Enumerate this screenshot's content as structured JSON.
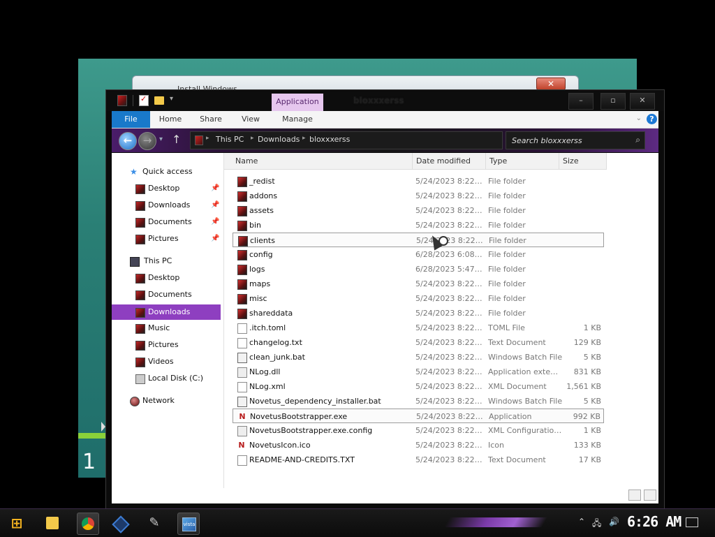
{
  "background_window": {
    "title": "Install Windows",
    "close_label": "✕",
    "side_digit": "1"
  },
  "explorer": {
    "title": "bloxxxerss",
    "contextual_tab_group": "Application Tools",
    "window_controls": {
      "minimize": "–",
      "maximize": "▫",
      "close": "✕"
    },
    "ribbon_tabs": [
      "File",
      "Home",
      "Share",
      "View",
      "Manage"
    ],
    "help_label": "?",
    "address": {
      "crumbs": [
        "This PC",
        "Downloads",
        "bloxxxerss"
      ]
    },
    "search": {
      "placeholder": "Search bloxxxerss"
    },
    "nav_pane": {
      "quick_access": {
        "label": "Quick access",
        "items": [
          "Desktop",
          "Downloads",
          "Documents",
          "Pictures"
        ]
      },
      "this_pc": {
        "label": "This PC",
        "items": [
          "Desktop",
          "Documents",
          "Downloads",
          "Music",
          "Pictures",
          "Videos",
          "Local Disk (C:)"
        ],
        "selected": "Downloads"
      },
      "network": {
        "label": "Network"
      }
    },
    "columns": [
      "Name",
      "Date modified",
      "Type",
      "Size"
    ],
    "files": [
      {
        "name": "_redist",
        "date": "5/24/2023 8:22…",
        "type": "File folder",
        "size": "",
        "icon": "folder"
      },
      {
        "name": "addons",
        "date": "5/24/2023 8:22…",
        "type": "File folder",
        "size": "",
        "icon": "folder"
      },
      {
        "name": "assets",
        "date": "5/24/2023 8:22…",
        "type": "File folder",
        "size": "",
        "icon": "folder"
      },
      {
        "name": "bin",
        "date": "5/24/2023 8:22…",
        "type": "File folder",
        "size": "",
        "icon": "folder"
      },
      {
        "name": "clients",
        "date": "5/24/2023 8:22…",
        "type": "File folder",
        "size": "",
        "icon": "folder",
        "highlighted": true
      },
      {
        "name": "config",
        "date": "6/28/2023 6:08…",
        "type": "File folder",
        "size": "",
        "icon": "folder"
      },
      {
        "name": "logs",
        "date": "6/28/2023 5:47…",
        "type": "File folder",
        "size": "",
        "icon": "folder"
      },
      {
        "name": "maps",
        "date": "5/24/2023 8:22…",
        "type": "File folder",
        "size": "",
        "icon": "folder"
      },
      {
        "name": "misc",
        "date": "5/24/2023 8:22…",
        "type": "File folder",
        "size": "",
        "icon": "folder"
      },
      {
        "name": "shareddata",
        "date": "5/24/2023 8:22…",
        "type": "File folder",
        "size": "",
        "icon": "folder"
      },
      {
        "name": ".itch.toml",
        "date": "5/24/2023 8:22…",
        "type": "TOML File",
        "size": "1 KB",
        "icon": "doc"
      },
      {
        "name": "changelog.txt",
        "date": "5/24/2023 8:22…",
        "type": "Text Document",
        "size": "129 KB",
        "icon": "doc"
      },
      {
        "name": "clean_junk.bat",
        "date": "5/24/2023 8:22…",
        "type": "Windows Batch File",
        "size": "5 KB",
        "icon": "bat"
      },
      {
        "name": "NLog.dll",
        "date": "5/24/2023 8:22…",
        "type": "Application exte…",
        "size": "831 KB",
        "icon": "dll"
      },
      {
        "name": "NLog.xml",
        "date": "5/24/2023 8:22…",
        "type": "XML Document",
        "size": "1,561 KB",
        "icon": "doc"
      },
      {
        "name": "Novetus_dependency_installer.bat",
        "date": "5/24/2023 8:22…",
        "type": "Windows Batch File",
        "size": "5 KB",
        "icon": "bat"
      },
      {
        "name": "NovetusBootstrapper.exe",
        "date": "5/24/2023 8:22…",
        "type": "Application",
        "size": "992 KB",
        "icon": "nov",
        "highlighted": true
      },
      {
        "name": "NovetusBootstrapper.exe.config",
        "date": "5/24/2023 8:22…",
        "type": "XML Configuratio…",
        "size": "1 KB",
        "icon": "dll"
      },
      {
        "name": "NovetusIcon.ico",
        "date": "5/24/2023 8:22…",
        "type": "Icon",
        "size": "133 KB",
        "icon": "nov"
      },
      {
        "name": "README-AND-CREDITS.TXT",
        "date": "5/24/2023 8:22…",
        "type": "Text Document",
        "size": "17 KB",
        "icon": "doc"
      }
    ]
  },
  "taskbar": {
    "clock": "6:26 AM",
    "apps": [
      "file-explorer",
      "chrome",
      "virtualbox",
      "tool",
      "vista-installer"
    ]
  },
  "colors": {
    "selection": "#8e3fc0",
    "file_tab": "#1979ca",
    "accent_purple": "#7a3aa8"
  }
}
